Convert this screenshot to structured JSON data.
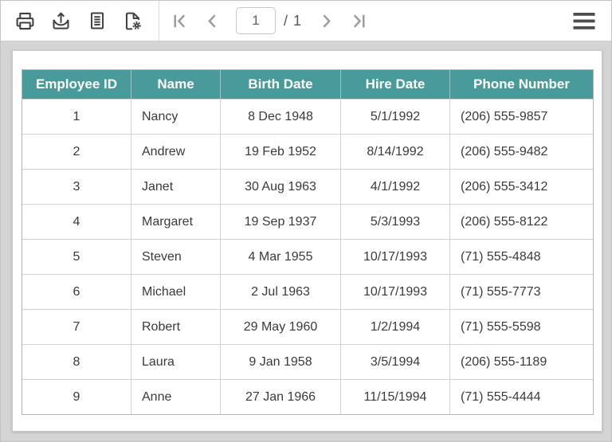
{
  "toolbar": {
    "buttons": [
      {
        "name": "print",
        "icon": "printer-icon"
      },
      {
        "name": "export",
        "icon": "export-icon"
      },
      {
        "name": "print-layout",
        "icon": "document-lines-icon"
      },
      {
        "name": "page-setup",
        "icon": "page-gear-icon"
      }
    ],
    "pager": {
      "first_icon": "first-page-icon",
      "prev_icon": "previous-page-icon",
      "current_page": "1",
      "total_pages_label": "/ 1",
      "next_icon": "next-page-icon",
      "last_icon": "last-page-icon"
    },
    "menu_icon": "hamburger-menu-icon"
  },
  "colors": {
    "accent_teal": "#489b9a",
    "content_background": "#d4d4d4",
    "toolbar_icon": "#3f3f3f",
    "disabled_nav_icon": "#9c9c9c",
    "header_text": "#ffffff",
    "cell_text": "#3a3a3a"
  },
  "table": {
    "columns": [
      "Employee ID",
      "Name",
      "Birth Date",
      "Hire Date",
      "Phone Number"
    ],
    "rows": [
      [
        "1",
        "Nancy",
        "8 Dec 1948",
        "5/1/1992",
        "(206) 555-9857"
      ],
      [
        "2",
        "Andrew",
        "19 Feb 1952",
        "8/14/1992",
        "(206) 555-9482"
      ],
      [
        "3",
        "Janet",
        "30 Aug 1963",
        "4/1/1992",
        "(206) 555-3412"
      ],
      [
        "4",
        "Margaret",
        "19 Sep 1937",
        "5/3/1993",
        "(206) 555-8122"
      ],
      [
        "5",
        "Steven",
        "4 Mar 1955",
        "10/17/1993",
        "(71) 555-4848"
      ],
      [
        "6",
        "Michael",
        "2 Jul 1963",
        "10/17/1993",
        "(71) 555-7773"
      ],
      [
        "7",
        "Robert",
        "29 May 1960",
        "1/2/1994",
        "(71) 555-5598"
      ],
      [
        "8",
        "Laura",
        "9 Jan 1958",
        "3/5/1994",
        "(206) 555-1189"
      ],
      [
        "9",
        "Anne",
        "27 Jan 1966",
        "11/15/1994",
        "(71) 555-4444"
      ]
    ]
  }
}
